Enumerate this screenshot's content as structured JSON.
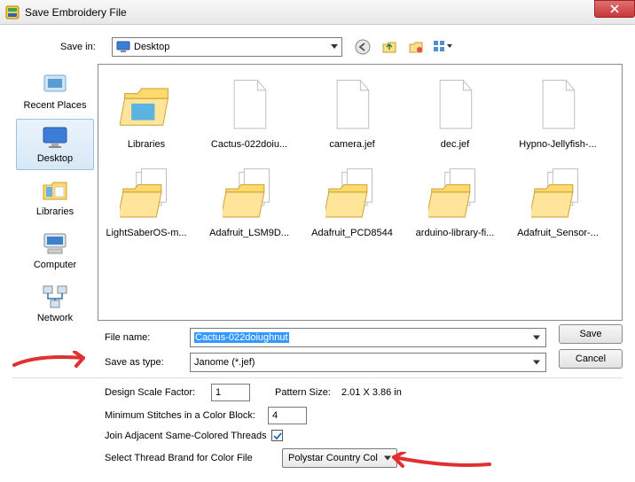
{
  "window": {
    "title": "Save Embroidery File"
  },
  "savein": {
    "label": "Save in:",
    "value": "Desktop"
  },
  "places": [
    {
      "key": "recent",
      "label": "Recent Places"
    },
    {
      "key": "desktop",
      "label": "Desktop"
    },
    {
      "key": "libraries",
      "label": "Libraries"
    },
    {
      "key": "computer",
      "label": "Computer"
    },
    {
      "key": "network",
      "label": "Network"
    }
  ],
  "files": [
    {
      "label": "Libraries",
      "icon": "folder-open"
    },
    {
      "label": "Cactus-022doiu...",
      "icon": "doc"
    },
    {
      "label": "camera.jef",
      "icon": "doc"
    },
    {
      "label": "dec.jef",
      "icon": "doc"
    },
    {
      "label": "Hypno-Jellyfish-...",
      "icon": "doc"
    },
    {
      "label": "LightSaberOS-m...",
      "icon": "folder-docs"
    },
    {
      "label": "Adafruit_LSM9D...",
      "icon": "folder-docs"
    },
    {
      "label": "Adafruit_PCD8544",
      "icon": "folder-docs"
    },
    {
      "label": "arduino-library-fi...",
      "icon": "folder-docs"
    },
    {
      "label": "Adafruit_Sensor-...",
      "icon": "folder-docs"
    }
  ],
  "form": {
    "filename_label": "File name:",
    "filename_value": "Cactus-022doiughnut",
    "savetype_label": "Save as type:",
    "savetype_value": "Janome (*.jef)"
  },
  "buttons": {
    "save": "Save",
    "cancel": "Cancel"
  },
  "settings": {
    "scale_label": "Design Scale Factor:",
    "scale_value": "1",
    "pattern_label": "Pattern Size:",
    "pattern_value": "2.01 X 3.86 in",
    "minstitch_label": "Minimum Stitches in a Color Block:",
    "minstitch_value": "4",
    "join_label": "Join Adjacent Same-Colored Threads",
    "join_checked": true,
    "thread_label": "Select Thread Brand for Color File",
    "thread_value": "Polystar Country Col"
  }
}
